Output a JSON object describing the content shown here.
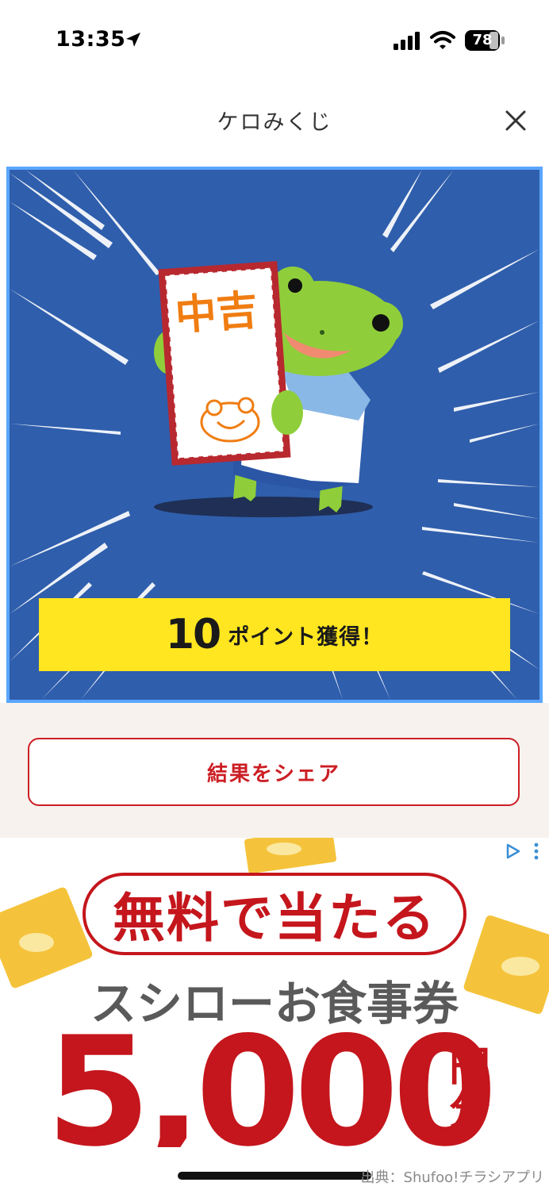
{
  "status_bar": {
    "time": "13:35",
    "battery": "78",
    "icons": [
      "location-arrow-icon",
      "cellular-signal-icon",
      "wifi-icon",
      "battery-icon"
    ]
  },
  "header": {
    "title": "ケロみくじ",
    "close_icon": "close-icon"
  },
  "result": {
    "fortune_text": "中吉",
    "points_value": "10",
    "points_label": "ポイント獲得！",
    "colors": {
      "panel_bg": "#2f5eac",
      "panel_border": "#5aa6ff",
      "banner": "#ffe620",
      "frog": "#8fce3a",
      "fortune_text": "#f07d12"
    }
  },
  "share": {
    "button_label": "結果をシェア",
    "accent": "#cc1e24"
  },
  "ad": {
    "headline": "無料で当たる",
    "subtitle": "スシローお食事券",
    "amount": "5,000",
    "unit": "円分",
    "ad_choices_icon": "ad-choices-icon",
    "accent": "#c4161c"
  },
  "credit": "出典：Shufoo!チラシアプリ"
}
